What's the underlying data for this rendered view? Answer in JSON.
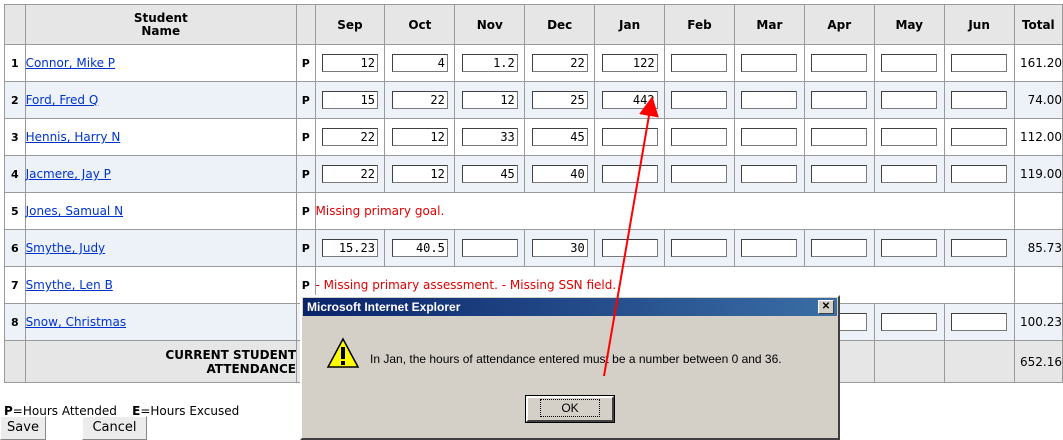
{
  "table": {
    "headers": {
      "student_name": "Student\nName",
      "months": [
        "Sep",
        "Oct",
        "Nov",
        "Dec",
        "Jan",
        "Feb",
        "Mar",
        "Apr",
        "May",
        "Jun"
      ],
      "total": "Total"
    },
    "rows": [
      {
        "num": "1",
        "name": "Connor, Mike P",
        "p": "P",
        "values": [
          "12",
          "4",
          "1.2",
          "22",
          "122",
          "",
          "",
          "",
          "",
          ""
        ],
        "total": "161.20"
      },
      {
        "num": "2",
        "name": "Ford, Fred Q",
        "p": "P",
        "values": [
          "15",
          "22",
          "12",
          "25",
          "442",
          "",
          "",
          "",
          "",
          ""
        ],
        "total": "74.00"
      },
      {
        "num": "3",
        "name": "Hennis, Harry N",
        "p": "P",
        "values": [
          "22",
          "12",
          "33",
          "45",
          "",
          "",
          "",
          "",
          "",
          ""
        ],
        "total": "112.00"
      },
      {
        "num": "4",
        "name": "Jacmere, Jay P",
        "p": "P",
        "values": [
          "22",
          "12",
          "45",
          "40",
          "",
          "",
          "",
          "",
          "",
          ""
        ],
        "total": "119.00"
      },
      {
        "num": "5",
        "name": "Jones, Samual N",
        "p": "P",
        "error": "Missing primary goal."
      },
      {
        "num": "6",
        "name": "Smythe, Judy",
        "p": "P",
        "values": [
          "15.23",
          "40.5",
          "",
          "30",
          "",
          "",
          "",
          "",
          "",
          ""
        ],
        "total": "85.73"
      },
      {
        "num": "7",
        "name": "Smythe, Len B",
        "p": "P",
        "error": "- Missing primary assessment. - Missing SSN field."
      },
      {
        "num": "8",
        "name": "Snow, Christmas",
        "p": "P",
        "values": [
          "",
          "",
          "",
          "",
          "",
          "",
          "",
          "",
          "",
          ""
        ],
        "total": "100.23"
      }
    ],
    "footer": {
      "label_line1": "CURRENT STUDENT",
      "label_line2": "ATTENDANCE",
      "total": "652.16"
    }
  },
  "legend": {
    "p_key": "P",
    "p_text": "=Hours Attended",
    "e_key": "E",
    "e_text": "=Hours Excused"
  },
  "buttons": {
    "save": "Save",
    "cancel": "Cancel"
  },
  "dialog": {
    "title": "Microsoft Internet Explorer",
    "close": "✕",
    "message": "In Jan, the hours of attendance entered must be a number between 0 and 36.",
    "ok": "OK",
    "icon": "warning-icon"
  },
  "colors": {
    "error": "#e00000",
    "link": "#0033cc",
    "title_bar": "#0a246a",
    "arrow": "#ff0000"
  }
}
